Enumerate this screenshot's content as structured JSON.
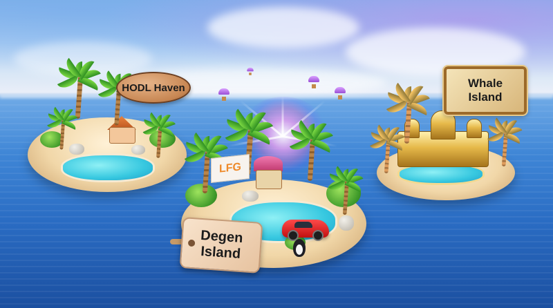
{
  "scene": {
    "islands": [
      {
        "id": "hodl",
        "sign_text": "HODL Haven"
      },
      {
        "id": "degen",
        "sign_line1": "Degen",
        "sign_line2": "Island",
        "banner_text": "LFG"
      },
      {
        "id": "whale",
        "sign_line1": "Whale",
        "sign_line2": "Island"
      }
    ],
    "airdrop_count": 4,
    "colors": {
      "sea": "#2a6cc3",
      "sand": "#f1d7a8",
      "pool": "#37c8e0",
      "gold": "#e6b94a",
      "palm_leaf": "#3f9a2a"
    }
  }
}
